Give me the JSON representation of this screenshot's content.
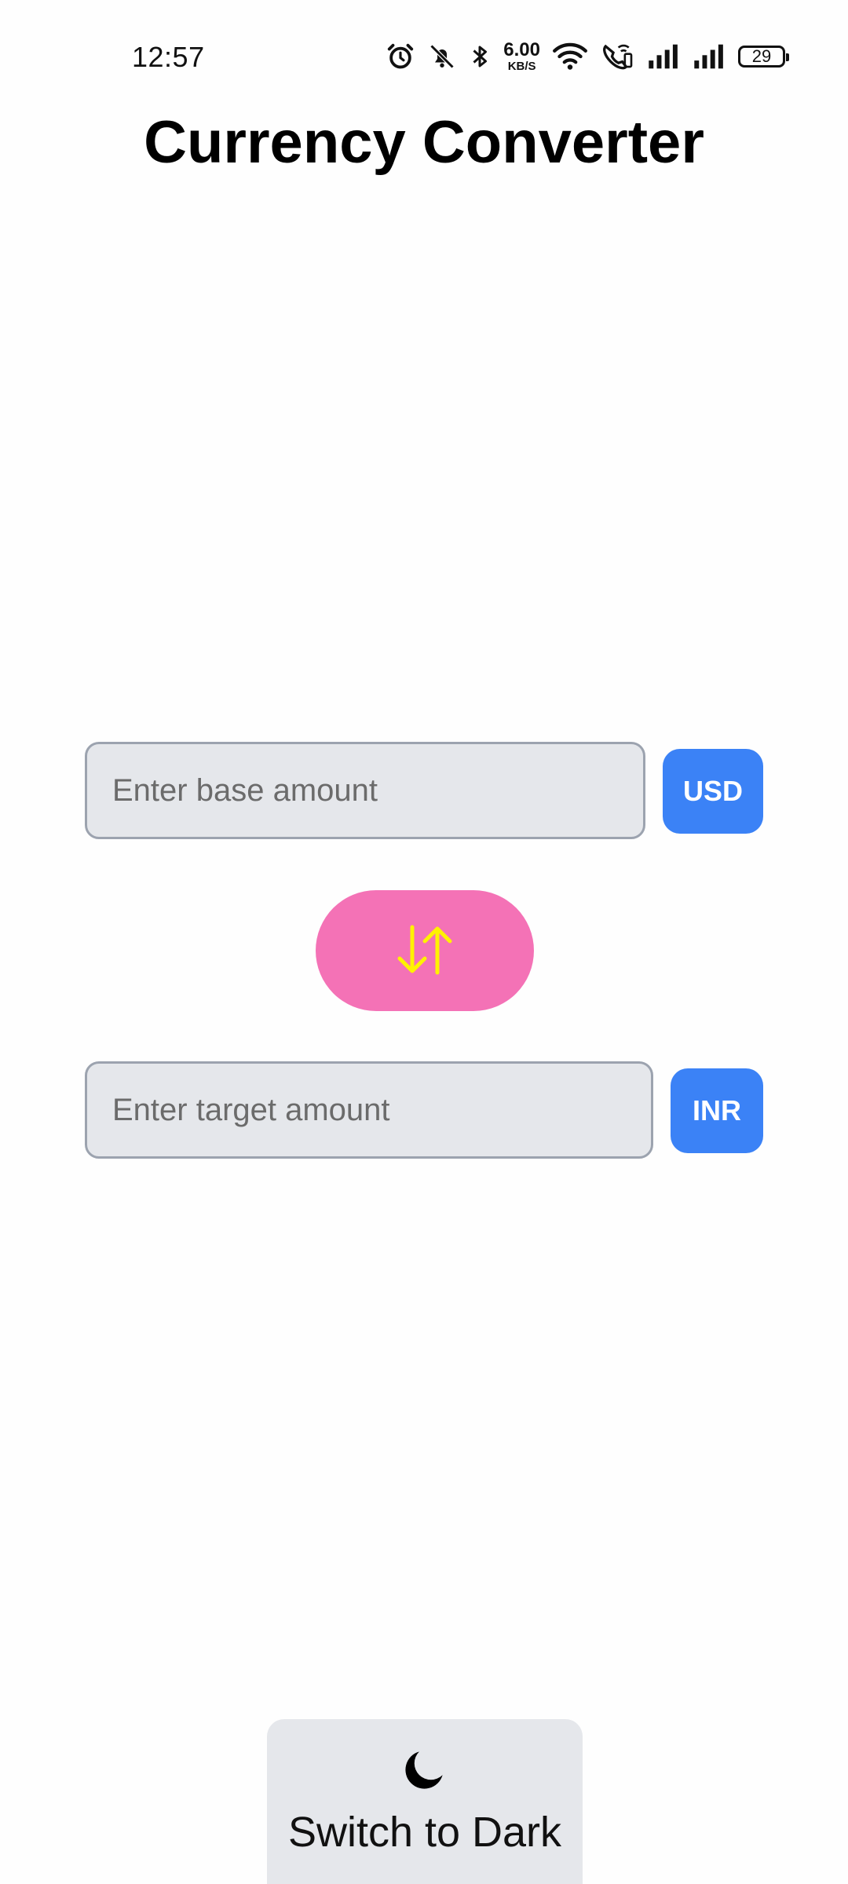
{
  "status_bar": {
    "time": "12:57",
    "net_speed_value": "6.00",
    "net_speed_unit": "KB/S",
    "battery": "29",
    "icons": [
      "alarm-icon",
      "mute-icon",
      "bluetooth-icon",
      "wifi-icon",
      "wifi-calling-icon",
      "signal-icon",
      "signal-icon"
    ]
  },
  "header": {
    "title": "Currency Converter"
  },
  "converter": {
    "base": {
      "placeholder": "Enter base amount",
      "value": "",
      "currency": "USD"
    },
    "swap_icon": "swap-vertical-icon",
    "target": {
      "placeholder": "Enter target amount",
      "value": "",
      "currency": "INR"
    }
  },
  "theme_toggle": {
    "icon": "moon-icon",
    "label": "Switch to Dark"
  },
  "colors": {
    "accent_blue": "#3b82f6",
    "swap_pink": "#f472b6",
    "swap_arrows_yellow": "#fff200",
    "field_bg": "#e5e7eb"
  }
}
